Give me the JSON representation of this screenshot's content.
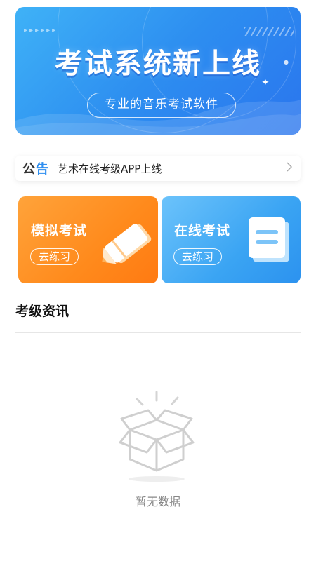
{
  "banner": {
    "title": "考试系统新上线",
    "subtitle": "专业的音乐考试软件"
  },
  "notice": {
    "tag_prefix": "公",
    "tag_suffix": "告",
    "text": "艺术在线考级APP上线",
    "icon": "chevron-right-icon"
  },
  "cards": [
    {
      "title": "模拟考试",
      "button": "去练习",
      "icon": "pencil-icon",
      "color": "#ff8a1c"
    },
    {
      "title": "在线考试",
      "button": "去练习",
      "icon": "clipboard-icon",
      "color": "#3aa4f3"
    }
  ],
  "section": {
    "title": "考级资讯"
  },
  "empty": {
    "icon": "empty-box-icon",
    "text": "暂无数据"
  },
  "colors": {
    "banner": "#2d8ef0",
    "accent": "#2d8ef0"
  }
}
